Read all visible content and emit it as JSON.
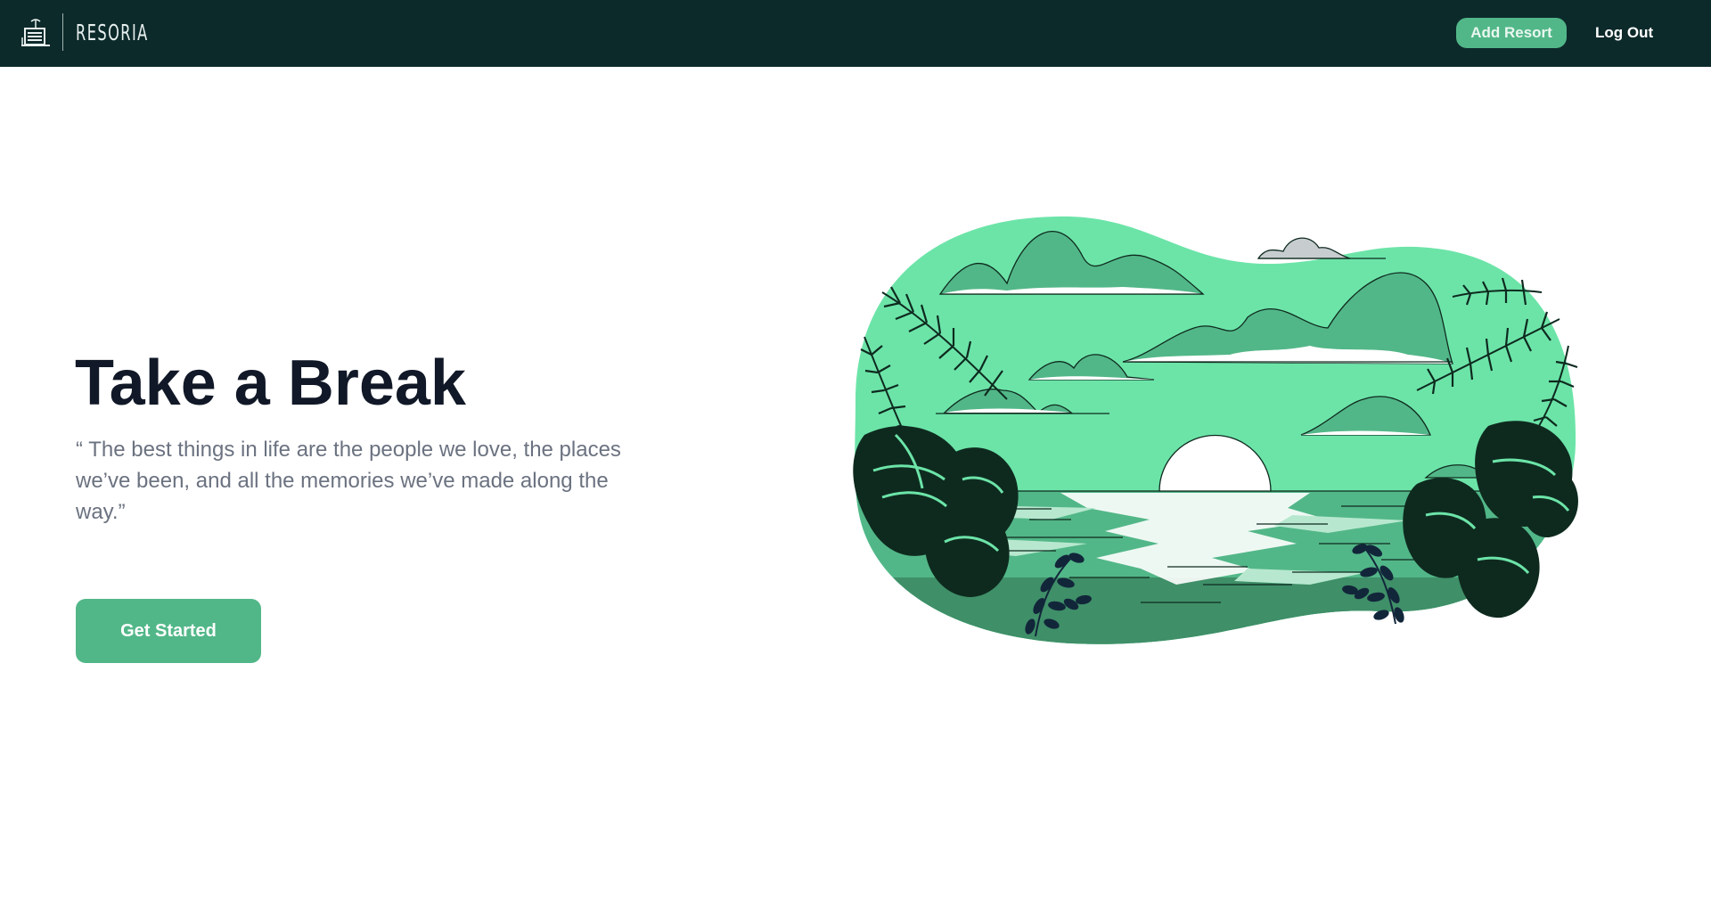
{
  "header": {
    "brand_name": "RESORIA",
    "add_resort_label": "Add Resort",
    "logout_label": "Log Out"
  },
  "hero": {
    "title": "Take a Break",
    "quote": "“ The best things in life are the people we love, the places we’ve been, and all the memories we’ve made along the way.”",
    "cta_label": "Get Started"
  },
  "colors": {
    "navbar_bg": "#0d2a2b",
    "accent_green": "#52b788",
    "light_green": "#6ce4a8",
    "dark_leaf": "#0e2a1f",
    "title_text": "#111827",
    "quote_text": "#6b7280"
  },
  "icons": {
    "brand": "beach-hotel-icon"
  }
}
